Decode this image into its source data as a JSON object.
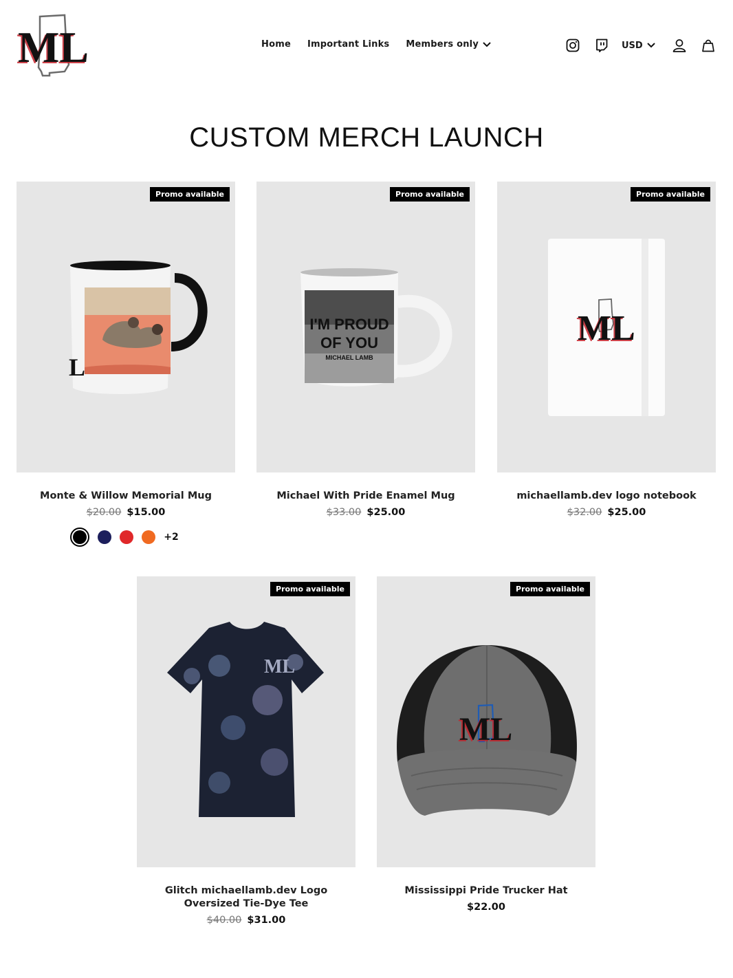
{
  "header": {
    "logo_text": "ML",
    "nav": [
      {
        "label": "Home"
      },
      {
        "label": "Important Links"
      },
      {
        "label": "Members only"
      }
    ],
    "currency": "USD",
    "icons": [
      "instagram-icon",
      "twitch-icon",
      "chevron-down-icon",
      "account-icon",
      "cart-bag-icon"
    ]
  },
  "page": {
    "title": "CUSTOM MERCH LAUNCH"
  },
  "products": [
    {
      "badge": "Promo available",
      "name": "Monte & Willow Memorial Mug",
      "price_old": "$20.00",
      "price": "$15.00",
      "swatches": [
        "#000000",
        "#1c1f5c",
        "#e0282a",
        "#f06a21"
      ],
      "swatch_more": "+2"
    },
    {
      "badge": "Promo available",
      "name": "Michael With Pride Enamel Mug",
      "price_old": "$33.00",
      "price": "$25.00",
      "mug_text_1": "I'M PROUD",
      "mug_text_2": "OF YOU",
      "mug_text_3": "MICHAEL LAMB"
    },
    {
      "badge": "Promo available",
      "name": "michaellamb.dev logo notebook",
      "price_old": "$32.00",
      "price": "$25.00"
    },
    {
      "badge": "Promo available",
      "name_line1": "Glitch michaellamb.dev Logo",
      "name_line2": "Oversized Tie-Dye Tee",
      "price_old": "$40.00",
      "price": "$31.00"
    },
    {
      "badge": "Promo available",
      "name": "Mississippi Pride Trucker Hat",
      "price": "$22.00"
    }
  ]
}
